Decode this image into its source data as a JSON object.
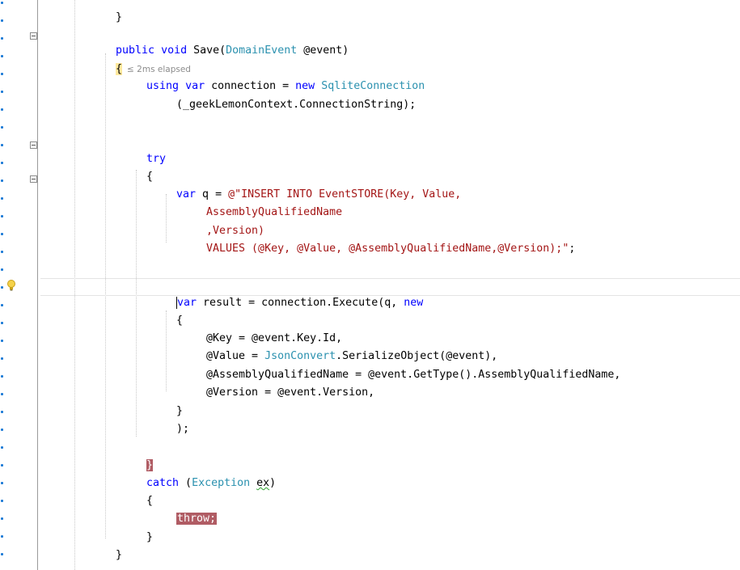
{
  "editor": {
    "elapsed_hint": "≤ 2ms elapsed",
    "lines": {
      "top_brace": "}",
      "sig_kw1": "public",
      "sig_kw2": "void",
      "sig_name": " Save(",
      "sig_type": "DomainEvent",
      "sig_rest": " @event)",
      "open_brace": "{",
      "using_kw": "using",
      "using_var": "var",
      "using_mid": " connection = ",
      "using_new": "new",
      "using_type": "SqliteConnection",
      "conn_string": "(_geekLemonContext.ConnectionString);",
      "try_kw": "try",
      "try_open": "{",
      "q_var": "var",
      "q_mid": " q = ",
      "q_str1": "@\"INSERT INTO EventSTORE(Key, Value,",
      "q_str2": "AssemblyQualifiedName",
      "q_str3": ",Version)",
      "q_str4": "VALUES (@Key, @Value, @AssemblyQualifiedName,@Version);\"",
      "q_end": ";",
      "res_var": "var",
      "res_mid": " result = connection.Execute(q, ",
      "res_new": "new",
      "anon_open": "{",
      "arg1": "@Key = @event.Key.Id,",
      "arg2_pre": "@Value = ",
      "arg2_type": "JsonConvert",
      "arg2_post": ".SerializeObject(@event),",
      "arg3": "@AssemblyQualifiedName = @event.GetType().AssemblyQualifiedName,",
      "arg4": "@Version = @event.Version,",
      "anon_close": "}",
      "exec_close": ");",
      "try_close": "}",
      "catch_kw": "catch",
      "catch_open_paren": " (",
      "catch_type": "Exception",
      "catch_space": " ",
      "catch_ex": "ex",
      "catch_close_paren": ")",
      "catch_open": "{",
      "throw_stmt": "throw;",
      "catch_close": "}",
      "method_close": "}"
    }
  },
  "colors": {
    "keyword": "#0000ff",
    "type": "#2b91af",
    "string": "#a31515",
    "exception_highlight": "#b05c64"
  },
  "icons": {
    "lightbulb": "lightbulb-icon",
    "fold": "collapse-toggle-icon"
  }
}
